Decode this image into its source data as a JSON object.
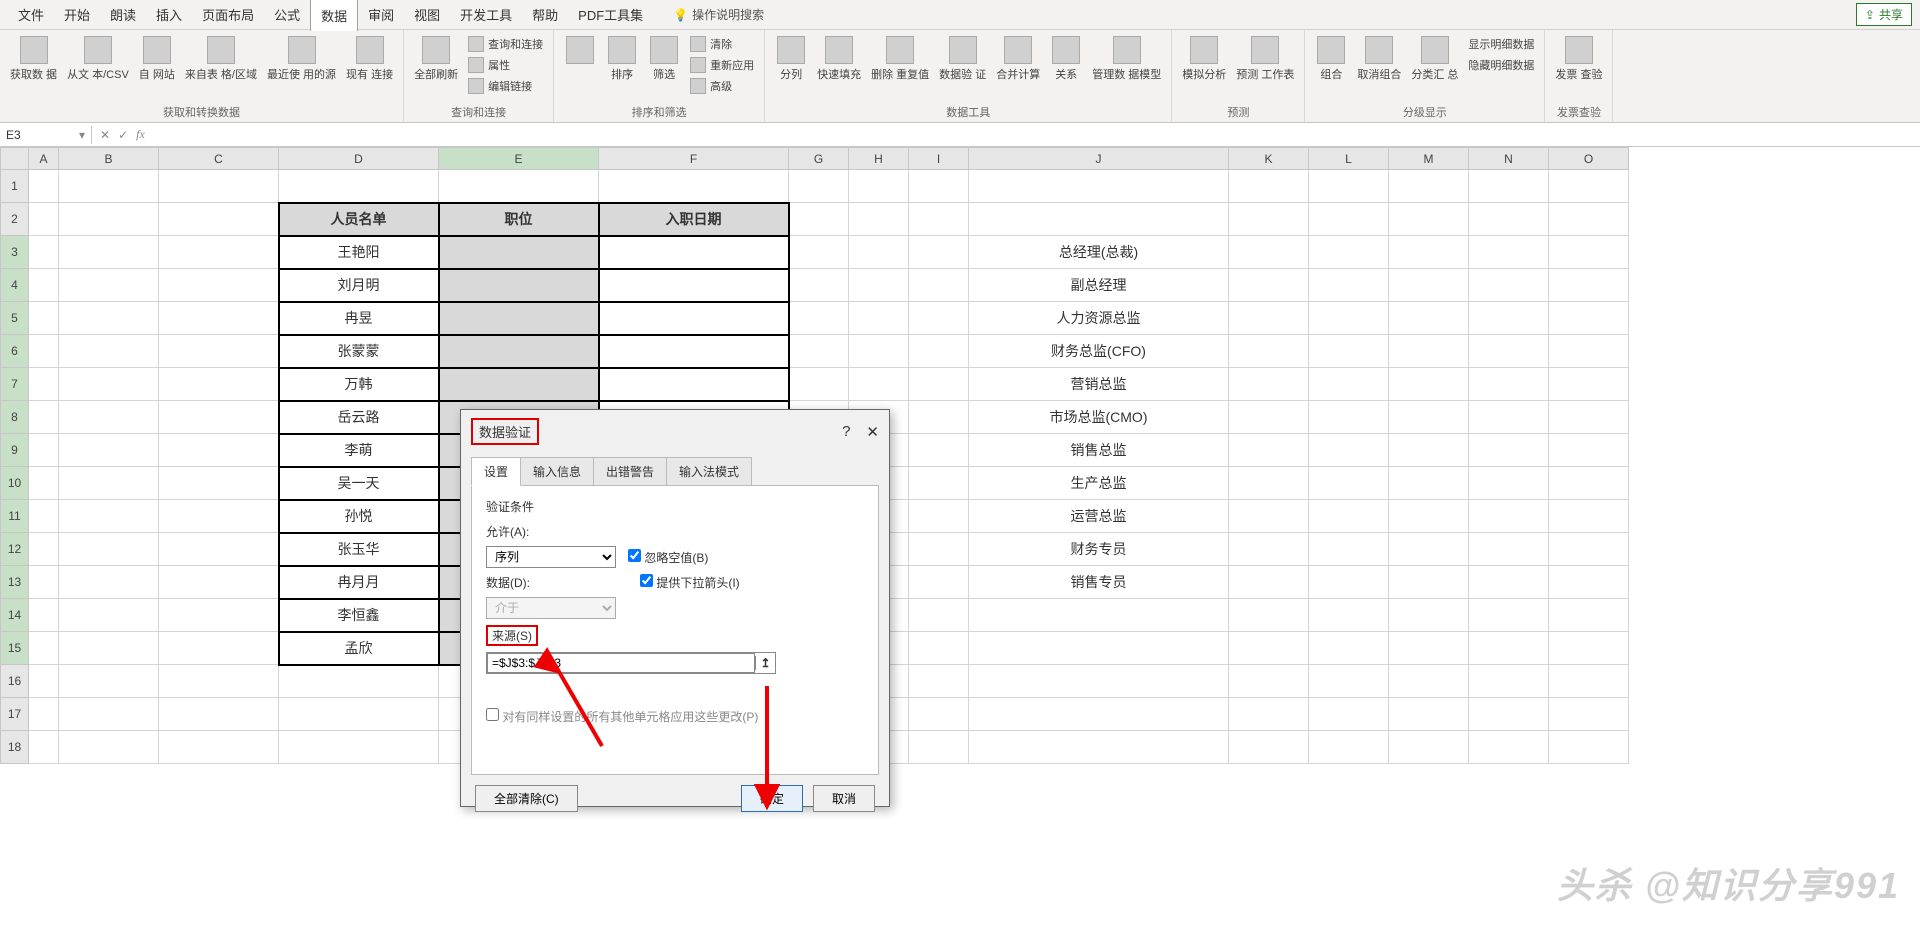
{
  "menu": {
    "items": [
      "文件",
      "开始",
      "朗读",
      "插入",
      "页面布局",
      "公式",
      "数据",
      "审阅",
      "视图",
      "开发工具",
      "帮助",
      "PDF工具集"
    ],
    "active": "数据",
    "tell_me": "操作说明搜索",
    "share": "共享"
  },
  "ribbon": {
    "groups": [
      {
        "label": "获取和转换数据",
        "buttons": [
          "获取数\n据",
          "从文\n本/CSV",
          "自\n网站",
          "来自表\n格/区域",
          "最近使\n用的源",
          "现有\n连接"
        ]
      },
      {
        "label": "查询和连接",
        "buttons": [
          "全部刷新"
        ],
        "side": [
          "查询和连接",
          "属性",
          "编辑链接"
        ]
      },
      {
        "label": "排序和筛选",
        "buttons": [
          "排序",
          "筛选"
        ],
        "side": [
          "清除",
          "重新应用",
          "高级"
        ]
      },
      {
        "label": "数据工具",
        "buttons": [
          "分列",
          "快速填充",
          "删除\n重复值",
          "数据验\n证",
          "合并计算",
          "关系",
          "管理数\n据模型"
        ]
      },
      {
        "label": "预测",
        "buttons": [
          "模拟分析",
          "预测\n工作表"
        ]
      },
      {
        "label": "分级显示",
        "buttons": [
          "组合",
          "取消组合",
          "分类汇\n总"
        ],
        "side": [
          "显示明细数据",
          "隐藏明细数据"
        ]
      },
      {
        "label": "发票查验",
        "buttons": [
          "发票\n查验"
        ]
      }
    ]
  },
  "namebox": "E3",
  "columns": [
    "A",
    "B",
    "C",
    "D",
    "E",
    "F",
    "G",
    "H",
    "I",
    "J",
    "K",
    "L",
    "M",
    "N",
    "O"
  ],
  "headers": {
    "D": "人员名单",
    "E": "职位",
    "F": "入职日期"
  },
  "names": [
    "王艳阳",
    "刘月明",
    "冉昱",
    "张蒙蒙",
    "万韩",
    "岳云路",
    "李萌",
    "吴一天",
    "孙悦",
    "张玉华",
    "冉月月",
    "李恒鑫",
    "孟欣"
  ],
  "positions": [
    "总经理(总裁)",
    "副总经理",
    "人力资源总监",
    "财务总监(CFO)",
    "营销总监",
    "市场总监(CMO)",
    "销售总监",
    "生产总监",
    "运营总监",
    "财务专员",
    "销售专员"
  ],
  "dialog": {
    "title": "数据验证",
    "tabs": [
      "设置",
      "输入信息",
      "出错警告",
      "输入法模式"
    ],
    "section": "验证条件",
    "allow_label": "允许(A):",
    "allow_value": "序列",
    "ignore_blank": "忽略空值(B)",
    "dropdown": "提供下拉箭头(I)",
    "data_label": "数据(D):",
    "data_value": "介于",
    "source_label": "来源(S)",
    "source_value": "=$J$3:$J$13",
    "apply_all": "对有同样设置的所有其他单元格应用这些更改(P)",
    "clear": "全部清除(C)",
    "ok": "确定",
    "cancel": "取消"
  },
  "watermark": "头杀 @知识分享991"
}
